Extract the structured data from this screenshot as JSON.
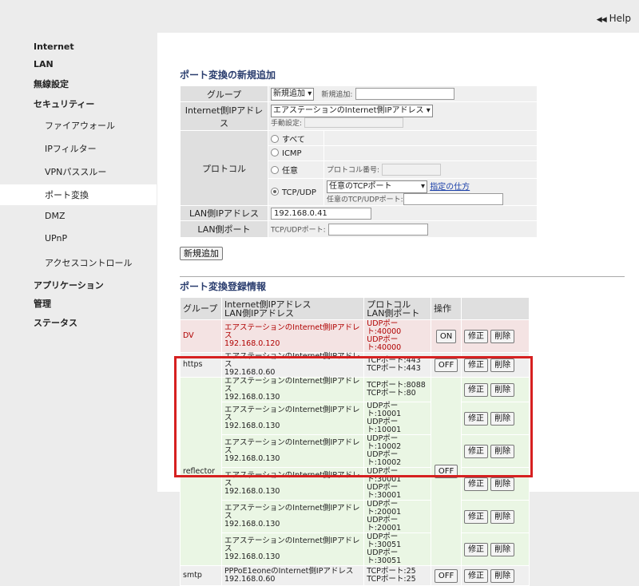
{
  "header": {
    "help_label": "Help"
  },
  "nav": {
    "internet": "Internet",
    "lan": "LAN",
    "wireless": "無線設定",
    "security": "セキュリティー",
    "firewall": "ファイアウォール",
    "ip_filter": "IPフィルター",
    "vpn": "VPNパススルー",
    "port_forward": "ポート変換",
    "dmz": "DMZ",
    "upnp": "UPnP",
    "access": "アクセスコントロール",
    "application": "アプリケーション",
    "admin": "管理",
    "status": "ステータス"
  },
  "form": {
    "title": "ポート変換の新規追加",
    "group_label": "グループ",
    "group_select": "新規追加",
    "new_add_label": "新規追加:",
    "inet_ip_label": "Internet側IPアドレス",
    "inet_ip_select": "エアステーションのInternet側IPアドレス",
    "manual_label": "手動設定:",
    "protocol_label": "プロトコル",
    "radio_all": "すべて",
    "radio_icmp": "ICMP",
    "radio_any": "任意",
    "proto_num_label": "プロトコル番号:",
    "radio_tcpudp": "TCP/UDP",
    "tcp_port_select": "任意のTCPポート",
    "how_to_link": "指定の仕方",
    "any_port_label": "任意のTCP/UDPポート:",
    "lan_ip_label": "LAN側IPアドレス",
    "lan_ip_value": "192.168.0.41",
    "lan_port_label": "LAN側ポート",
    "lan_port_prefix": "TCP/UDPポート:",
    "submit_label": "新規追加"
  },
  "list": {
    "title": "ポート変換登録情報",
    "head_group": "グループ",
    "head_ip1": "Internet側IPアドレス",
    "head_ip2": "LAN側IPアドレス",
    "head_port1": "プロトコル",
    "head_port2": "LAN側ポート",
    "head_action": "操作",
    "edit": "修正",
    "delete": "削除",
    "dv": {
      "group": "DV",
      "ip1": "エアステーションのInternet側IPアドレス",
      "ip2": "192.168.0.120",
      "p1": "UDPポート:40000",
      "p2": "UDPポート:40000",
      "toggle": "ON"
    },
    "https": {
      "group": "https",
      "ip1": "エアステーションのInternet側IPアドレス",
      "ip2": "192.168.0.60",
      "p1": "TCPポート:443",
      "p2": "TCPポート:443",
      "toggle": "OFF"
    },
    "reflector": {
      "group": "reflector",
      "toggle": "OFF",
      "rows": [
        {
          "ip1": "エアステーションのInternet側IPアドレス",
          "ip2": "192.168.0.130",
          "p1": "TCPポート:8088",
          "p2": "TCPポート:80"
        },
        {
          "ip1": "エアステーションのInternet側IPアドレス",
          "ip2": "192.168.0.130",
          "p1": "UDPポート:10001",
          "p2": "UDPポート:10001"
        },
        {
          "ip1": "エアステーションのInternet側IPアドレス",
          "ip2": "192.168.0.130",
          "p1": "UDPポート:10002",
          "p2": "UDPポート:10002"
        },
        {
          "ip1": "エアステーションのInternet側IPアドレス",
          "ip2": "192.168.0.130",
          "p1": "UDPポート:30001",
          "p2": "UDPポート:30001"
        },
        {
          "ip1": "エアステーションのInternet側IPアドレス",
          "ip2": "192.168.0.130",
          "p1": "UDPポート:20001",
          "p2": "UDPポート:20001"
        },
        {
          "ip1": "エアステーションのInternet側IPアドレス",
          "ip2": "192.168.0.130",
          "p1": "UDPポート:30051",
          "p2": "UDPポート:30051"
        }
      ]
    },
    "smtp": {
      "group": "smtp",
      "ip1": "PPPoE1eoneのInternet側IPアドレス",
      "ip2": "192.168.0.60",
      "p1": "TCPポート:25",
      "p2": "TCPポート:25",
      "toggle": "OFF"
    }
  }
}
